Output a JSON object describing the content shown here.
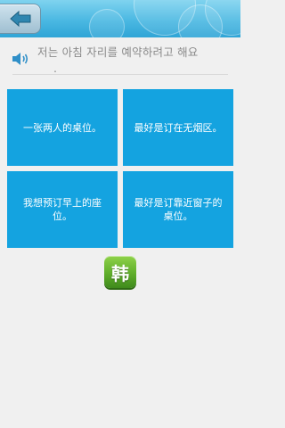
{
  "header": {
    "back_icon": "back-arrow-icon"
  },
  "question": {
    "audio_icon": "speaker-icon",
    "line1": "저는 아침 자리를 예약하려고 해요",
    "line2": "."
  },
  "options": [
    {
      "label": "一张两人的桌位。"
    },
    {
      "label": "最好是订在无烟区。"
    },
    {
      "label": "我想预订早上的座位。"
    },
    {
      "label": "最好是订靠近窗子的桌位。"
    }
  ],
  "language_button": {
    "label": "韩",
    "icon": "language-korean-icon"
  },
  "colors": {
    "header": "#4ab8e2",
    "option_bg": "#14a3e0",
    "option_text": "#ffffff",
    "question_text": "#8a8a8a",
    "language_button": "#5fae2a",
    "background": "#f0f0f0"
  }
}
